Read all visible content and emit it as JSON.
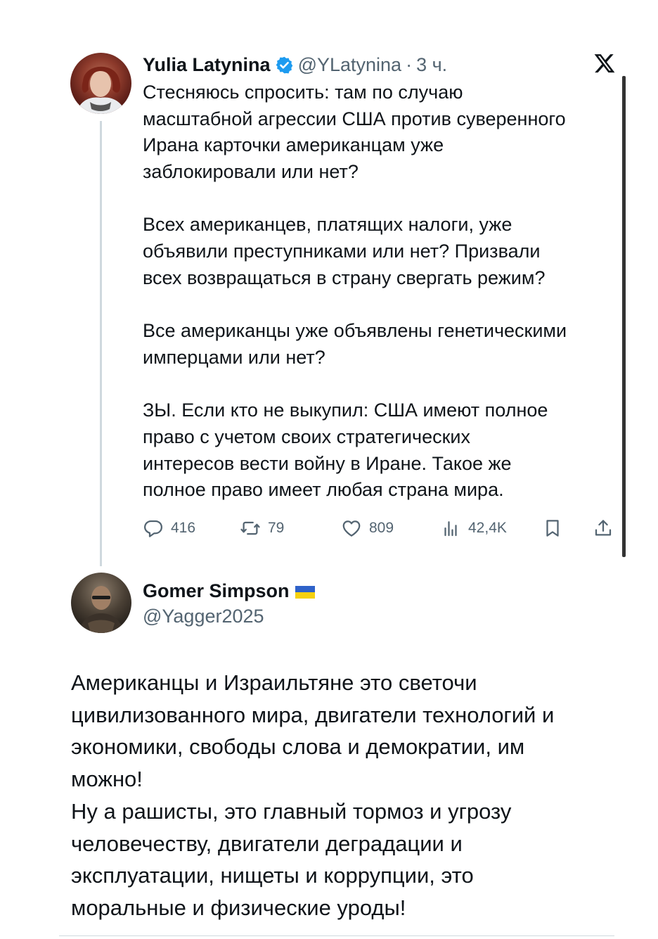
{
  "original_tweet": {
    "author": {
      "display_name": "Yulia Latynina",
      "handle": "@YLatynina",
      "verified": true,
      "avatar_icon": "avatar-icon"
    },
    "separator": "·",
    "timestamp": "3 ч.",
    "platform_logo": "x-logo-icon",
    "paragraphs": [
      [
        "Стесняюсь спросить: там по случаю",
        "масштабной агрессии США против суверенного",
        "Ирана карточки американцам уже",
        "заблокировали или нет?"
      ],
      [
        "Всех американцев, платящих налоги, уже",
        "объявили преступниками или нет? Призвали",
        "всех возвращаться в страну свергать режим?"
      ],
      [
        "Все американцы уже объявлены генетическими",
        "имперцами или нет?"
      ],
      [
        "ЗЫ. Если кто не выкупил: США имеют полное",
        "право с учетом своих стратегических",
        "интересов вести войну в Иране. Такое же",
        "полное право имеет любая страна мира."
      ]
    ],
    "actions": {
      "replies": "416",
      "reposts": "79",
      "likes": "809",
      "views": "42,4K",
      "bookmark_icon": "bookmark-icon",
      "share_icon": "share-icon"
    }
  },
  "reply_post": {
    "author": {
      "display_name": "Gomer Simpson",
      "handle": "@Yagger2025",
      "flag_icon": "ukraine-flag-icon",
      "avatar_icon": "avatar-icon"
    },
    "lines": [
      "Американцы и Израильтяне это светочи",
      "цивилизованного мира, двигатели технологий и",
      "экономики, свободы слова и демократии, им",
      "можно!",
      "Ну а рашисты, это главный тормоз и угрозу",
      "человечеству, двигатели деградации и",
      "эксплуатации, нищеты и коррупции, это",
      "моральные и физические уроды!"
    ]
  },
  "colors": {
    "text_primary": "#0f1419",
    "text_secondary": "#536471",
    "verified_blue": "#1d9bf0",
    "thread_line": "#cfd9de",
    "flag_blue": "#2f62c9",
    "flag_yellow": "#f6d10f"
  }
}
